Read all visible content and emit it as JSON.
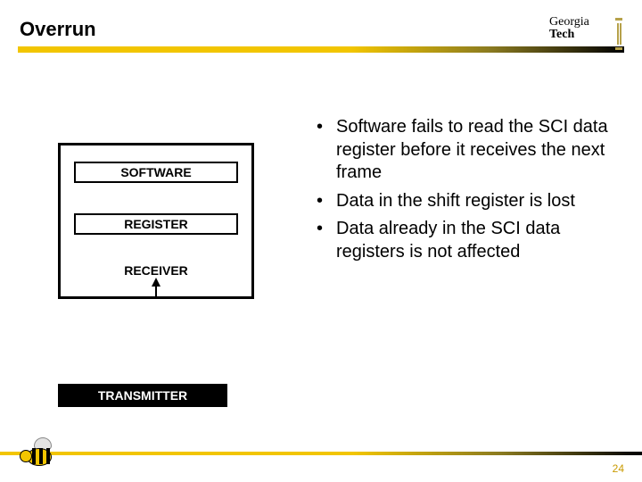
{
  "title": "Overrun",
  "logo": {
    "line1": "Georgia",
    "line2": "Tech"
  },
  "diagram": {
    "software_label": "SOFTWARE",
    "register_label": "REGISTER",
    "receiver_label": "RECEIVER"
  },
  "transmitter_label": "TRANSMITTER",
  "bullets": [
    "Software fails to read the SCI data register before it receives the next frame",
    "Data in the shift register is lost",
    "Data already in the SCI data registers is not affected"
  ],
  "page_number": "24"
}
